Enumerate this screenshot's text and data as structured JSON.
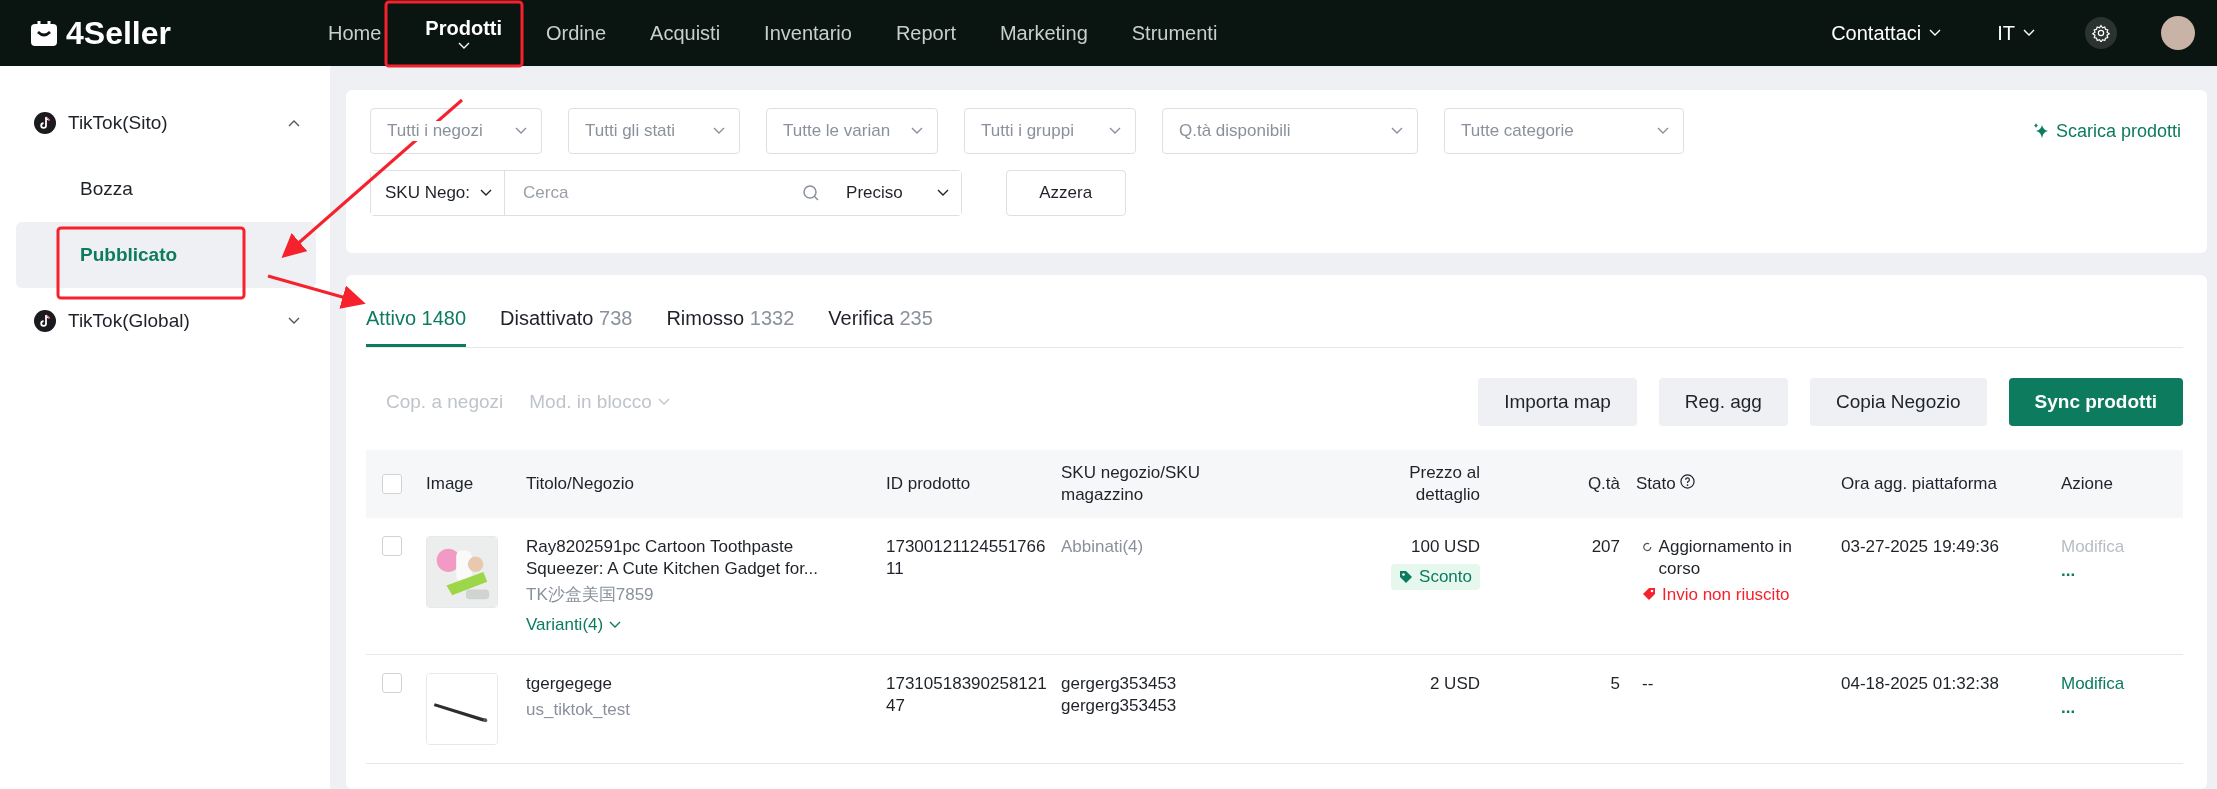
{
  "topbar": {
    "logo": "4Seller",
    "nav": [
      {
        "label": "Home",
        "selected": false
      },
      {
        "label": "Prodotti",
        "selected": true
      },
      {
        "label": "Ordine",
        "selected": false
      },
      {
        "label": "Acquisti",
        "selected": false
      },
      {
        "label": "Inventario",
        "selected": false
      },
      {
        "label": "Report",
        "selected": false
      },
      {
        "label": "Marketing",
        "selected": false
      },
      {
        "label": "Strumenti",
        "selected": false
      }
    ],
    "contact": "Contattaci",
    "language": "IT"
  },
  "sidebar": {
    "groups": [
      {
        "label": "TikTok(Sito)",
        "expanded": true,
        "children": [
          {
            "label": "Bozza",
            "selected": false
          },
          {
            "label": "Pubblicato",
            "selected": true
          }
        ]
      },
      {
        "label": "TikTok(Global)",
        "expanded": false
      }
    ]
  },
  "filters": {
    "dropdowns": [
      "Tutti i negozi",
      "Tutti gli stati",
      "Tutte le varian",
      "Tutti i gruppi",
      "Q.tà disponibili",
      "Tutte categorie"
    ],
    "download": "Scarica prodotti",
    "search_field": "SKU Nego:",
    "search": {
      "placeholder": "Cerca"
    },
    "match": "Preciso",
    "reset": "Azzera"
  },
  "tabs": [
    {
      "label": "Attivo",
      "count": "1480",
      "selected": true
    },
    {
      "label": "Disattivato",
      "count": "738",
      "selected": false
    },
    {
      "label": "Rimosso",
      "count": "1332",
      "selected": false
    },
    {
      "label": "Verifica",
      "count": "235",
      "selected": false
    }
  ],
  "bulk_actions": [
    {
      "label": "Cop. a negozi",
      "kind": "link",
      "disabled": true
    },
    {
      "label": "Mod. in blocco",
      "kind": "dropdown",
      "disabled": true
    }
  ],
  "buttons": [
    {
      "label": "Importa map",
      "kind": "secondary"
    },
    {
      "label": "Reg. agg",
      "kind": "secondary"
    },
    {
      "label": "Copia Negozio",
      "kind": "secondary"
    },
    {
      "label": "Sync prodotti",
      "kind": "primary"
    }
  ],
  "table": {
    "select_all_checked": false,
    "columns": [
      "Image",
      "Titolo/Negozio",
      "ID prodotto",
      "SKU negozio/SKU magazzino",
      "Prezzo al dettaglio",
      "Q.tà",
      "Stato",
      "Ora agg. piattaforma",
      "Azione"
    ],
    "rows": [
      {
        "checked": false,
        "title": "Ray8202591pc Cartoon Toothpaste Squeezer: A Cute Kitchen Gadget for...",
        "shop": "TK沙盒美国7859",
        "variants": "Varianti(4)",
        "product_id": "1730012112455176611",
        "sku_link": "Abbinati(4)",
        "skus": [],
        "price": "100 USD",
        "discount": "Sconto",
        "qty": "207",
        "statuses": [
          {
            "kind": "syncing",
            "label": "Aggiornamento in corso"
          },
          {
            "kind": "failed",
            "label": "Invio non riuscito"
          }
        ],
        "status_text": "",
        "time": "03-27-2025 19:49:36",
        "action": "Modifica",
        "action_disabled": true,
        "more": "..."
      },
      {
        "checked": false,
        "title": "tgergegege",
        "shop": "us_tiktok_test",
        "variants": "",
        "product_id": "1731051839025812147",
        "sku_link": "",
        "skus": [
          "gergerg353453",
          "gergerg353453"
        ],
        "price": "2 USD",
        "discount": "",
        "qty": "5",
        "statuses": [],
        "status_text": "--",
        "time": "04-18-2025 01:32:38",
        "action": "Modifica",
        "action_disabled": false,
        "more": "..."
      }
    ]
  }
}
